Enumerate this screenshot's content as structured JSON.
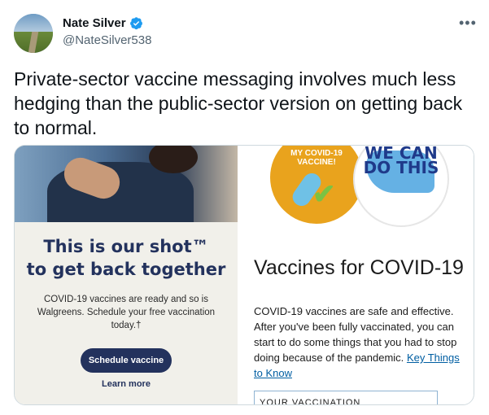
{
  "tweet": {
    "author_name": "Nate Silver",
    "handle": "@NateSilver538",
    "more_label": "•••",
    "text": "Private-sector vaccine messaging involves much less hedging than the public-sector version on getting back to normal."
  },
  "card": {
    "left": {
      "title_line1": "This is our shot™",
      "title_line2": "to get back together",
      "body": "COVID-19 vaccines are ready and so is Walgreens. Schedule your free vaccination today.†",
      "button_label": "Schedule vaccine",
      "link_label": "Learn more"
    },
    "right": {
      "badge1_text": "MY COVID-19 VACCINE!",
      "badge2_text": "WE CAN DO THIS",
      "title": "Vaccines for COVID-19",
      "body": "COVID-19 vaccines are safe and effective. After you've been fully vaccinated, you can start to do some things that you had to stop doing because of the pandemic.",
      "link_label": "Key Things to Know",
      "section_label": "YOUR VACCINATION"
    }
  },
  "colors": {
    "walgreens_navy": "#23325d",
    "verified_blue": "#1d9bf0",
    "cdc_link": "#005ea2"
  }
}
